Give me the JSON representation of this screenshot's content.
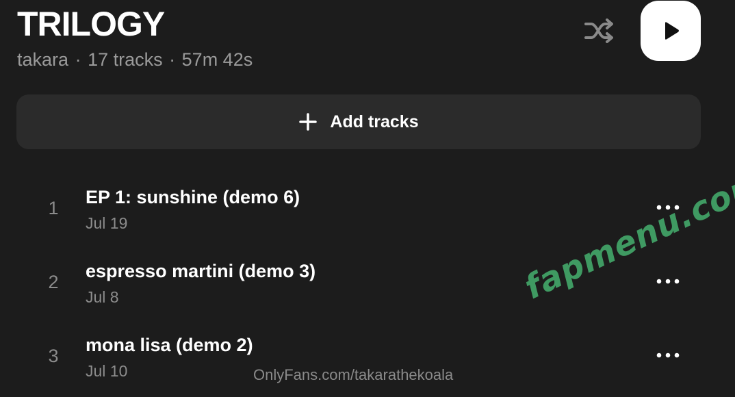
{
  "playlist": {
    "title": "TRILOGY",
    "artist": "takara",
    "separator": "·",
    "track_count": "17 tracks",
    "duration": "57m 42s"
  },
  "controls": {
    "shuffle_icon": "shuffle-icon",
    "play_icon": "play-icon"
  },
  "add_tracks": {
    "icon": "plus-icon",
    "label": "Add tracks"
  },
  "tracks": [
    {
      "number": "1",
      "title": "EP 1: sunshine (demo 6)",
      "date": "Jul 19",
      "more_icon": "more-horizontal-icon"
    },
    {
      "number": "2",
      "title": "espresso martini (demo 3)",
      "date": "Jul 8",
      "more_icon": "more-horizontal-icon"
    },
    {
      "number": "3",
      "title": "mona lisa (demo 2)",
      "date": "Jul 10",
      "more_icon": "more-horizontal-icon"
    }
  ],
  "watermarks": {
    "logo_text": "fapmenu.com",
    "url_text": "OnlyFans.com/takarathekoala"
  },
  "colors": {
    "background": "#1c1c1c",
    "button_bg": "#2b2b2b",
    "text_primary": "#ffffff",
    "text_secondary": "#8c8c8c",
    "watermark_green": "#3f9a62"
  }
}
